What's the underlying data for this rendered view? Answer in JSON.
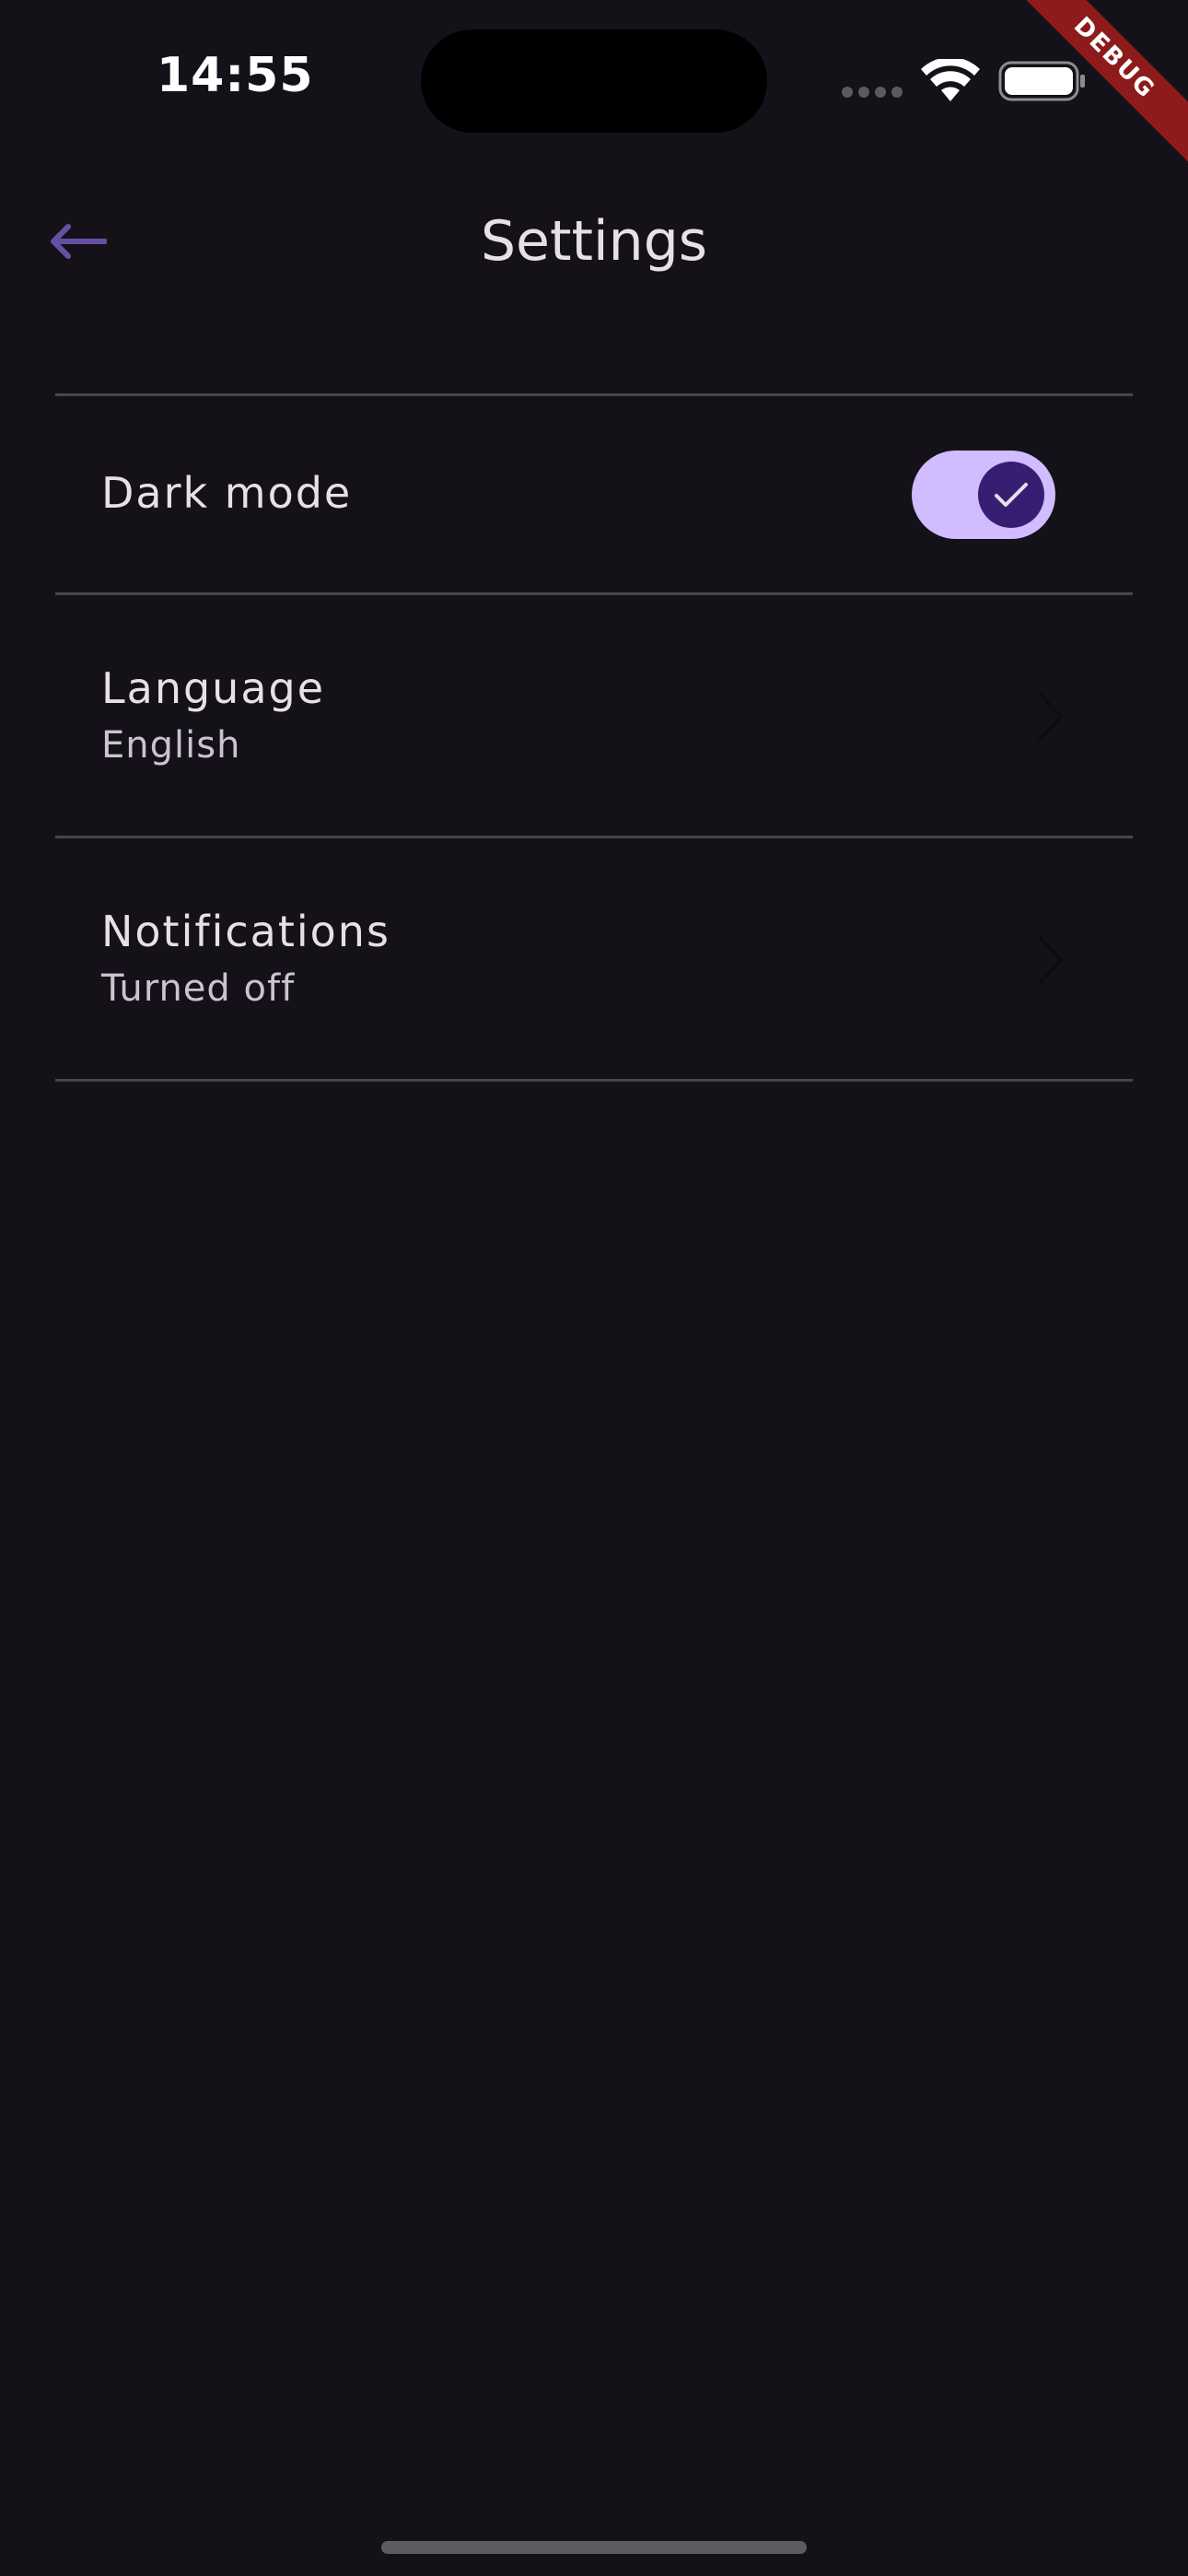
{
  "status_bar": {
    "time": "14:55",
    "icons": [
      "cellular-signal-icon",
      "wifi-icon",
      "battery-icon"
    ]
  },
  "debug_banner": "DEBUG",
  "app_bar": {
    "title": "Settings",
    "back_icon": "arrow-back-icon"
  },
  "settings": {
    "dark_mode": {
      "label": "Dark mode",
      "enabled": true
    },
    "language": {
      "label": "Language",
      "value": "English"
    },
    "notifications": {
      "label": "Notifications",
      "value": "Turned off"
    }
  },
  "colors": {
    "background": "#141218",
    "accent": "#6750a4",
    "toggle_track": "#d0bcff",
    "toggle_thumb": "#381e72",
    "debug_banner": "#8e1b1b"
  }
}
